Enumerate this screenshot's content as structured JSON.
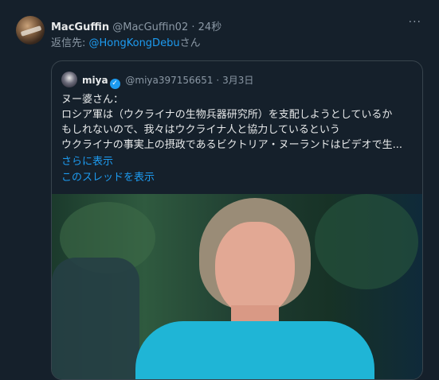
{
  "tweet": {
    "display_name": "MacGuffin",
    "handle": "@MacGuffin02",
    "separator": "·",
    "time": "24秒",
    "more": "···",
    "reply_prefix": "返信先: ",
    "reply_mention": "@HongKongDebu",
    "reply_suffix": "さん"
  },
  "quote": {
    "display_name": "miya",
    "verified_glyph": "✓",
    "handle": "@miya397156651",
    "separator": "·",
    "date": "3月3日",
    "lines": [
      "ヌー婆さん：",
      "ロシア軍は（ウクライナの生物兵器研究所）を支配しようとしているか",
      "もしれないので、我々はウクライナ人と協力しているという",
      "ウクライナの事実上の摂政であるビクトリア・ヌーランドはビデオで生..."
    ],
    "show_more": "さらに表示",
    "show_thread": "このスレッドを表示"
  },
  "colors": {
    "background": "#15202b",
    "text": "#e7e9ea",
    "muted": "#8b98a5",
    "accent": "#1d9bf0",
    "border": "#38444d"
  },
  "icons": {
    "more": "more-horizontal-icon",
    "verified": "verified-badge-icon"
  }
}
